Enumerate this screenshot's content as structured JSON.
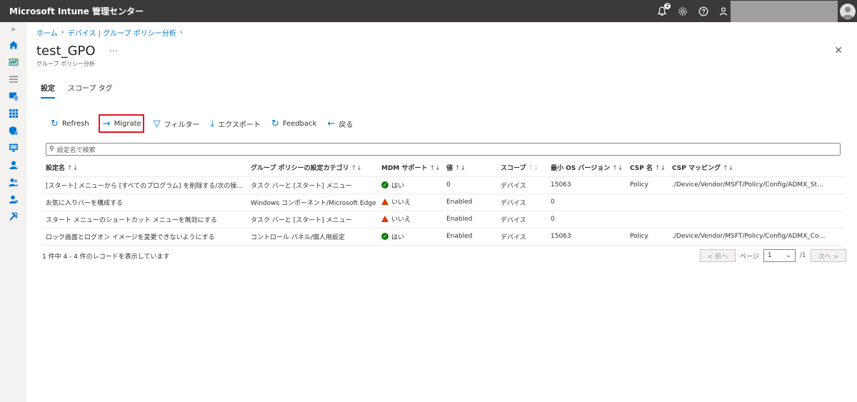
{
  "app": {
    "title": "Microsoft Intune 管理センター",
    "notification_count": "2"
  },
  "breadcrumb": [
    "ホーム",
    "デバイス | グループ ポリシー分析"
  ],
  "page": {
    "title": "test_GPO",
    "more": "…",
    "subtitle": "グループ ポリシー分析",
    "close": "✕"
  },
  "tabs": [
    {
      "label": "設定"
    },
    {
      "label": "スコープ タグ"
    }
  ],
  "toolbar": {
    "refresh": "Refresh",
    "migrate": "Migrate",
    "filter": "フィルター",
    "export": "エクスポート",
    "feedback": "Feedback",
    "back": "戻る"
  },
  "search": {
    "placeholder": "設定名で検索"
  },
  "table": {
    "headers": [
      "設定名",
      "グループ ポリシーの設定カテゴリ",
      "MDM サポート",
      "値",
      "スコープ",
      "最小 OS バージョン",
      "CSP 名",
      "CSP マッピング"
    ],
    "rows": [
      {
        "name": "[スタート] メニューから [すべてのプログラム] を削除する/次の操作から…",
        "category": "タスク バーと [スタート] メニュー",
        "mdm": "はい",
        "mdm_status": "ok",
        "value": "0",
        "scope": "デバイス",
        "min_os": "15063",
        "csp": "Policy",
        "mapping": "./Device/Vendor/MSFT/Policy/Config/ADMX_St…"
      },
      {
        "name": "お気に入りバーを構成する",
        "category": "Windows コンポーネント/Microsoft Edge",
        "mdm": "いいえ",
        "mdm_status": "warn",
        "value": "Enabled",
        "scope": "デバイス",
        "min_os": "0",
        "csp": "",
        "mapping": ""
      },
      {
        "name": "スタート メニューのショートカット メニューを無効にする",
        "category": "タスク バーと [スタート] メニュー",
        "mdm": "いいえ",
        "mdm_status": "warn",
        "value": "Enabled",
        "scope": "デバイス",
        "min_os": "0",
        "csp": "",
        "mapping": ""
      },
      {
        "name": "ロック画面とログオン イメージを変更できないようにする",
        "category": "コントロール パネル/個人用設定",
        "mdm": "はい",
        "mdm_status": "ok",
        "value": "Enabled",
        "scope": "デバイス",
        "min_os": "15063",
        "csp": "Policy",
        "mapping": "./Device/Vendor/MSFT/Policy/Config/ADMX_Co…"
      }
    ]
  },
  "footer": {
    "records": "1 件中 4 - 4 件のレコードを表示しています"
  },
  "pager": {
    "prev": "< 前へ",
    "page_label": "ページ",
    "page_value": "1",
    "page_total": "/1",
    "next": "次へ >"
  },
  "colors": {
    "accent": "#0078d4",
    "topbar": "#3b3a39",
    "highlight": "#e81123",
    "ok": "#107c10",
    "warn": "#d83b01"
  }
}
